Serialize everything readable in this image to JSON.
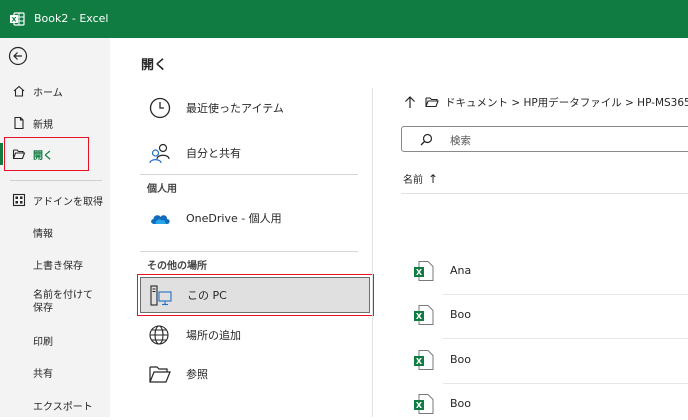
{
  "window": {
    "title": "Book2  -  Excel"
  },
  "nav": {
    "home": "ホーム",
    "new": "新規",
    "open": "開く",
    "addins": "アドインを取得",
    "info": "情報",
    "save": "上書き保存",
    "save_as": "名前を付けて保存",
    "print": "印刷",
    "share": "共有",
    "export": "エクスポート"
  },
  "main": {
    "title": "開く",
    "recent": "最近使ったアイテム",
    "shared": "自分と共有",
    "personal_heading": "個人用",
    "onedrive": "OneDrive - 個人用",
    "other_heading": "その他の場所",
    "this_pc": "この PC",
    "add_place": "場所の追加",
    "browse": "参照"
  },
  "browser": {
    "breadcrumb": "ドキュメント > HP用データファイル > HP-MS365",
    "search_placeholder": "検索",
    "column_name": "名前",
    "sort_arrow": "↑",
    "files": [
      "Ana",
      "Boo",
      "Boo",
      "Boo"
    ]
  },
  "colors": {
    "excel_green": "#107c41",
    "highlight_red": "#e81123"
  }
}
